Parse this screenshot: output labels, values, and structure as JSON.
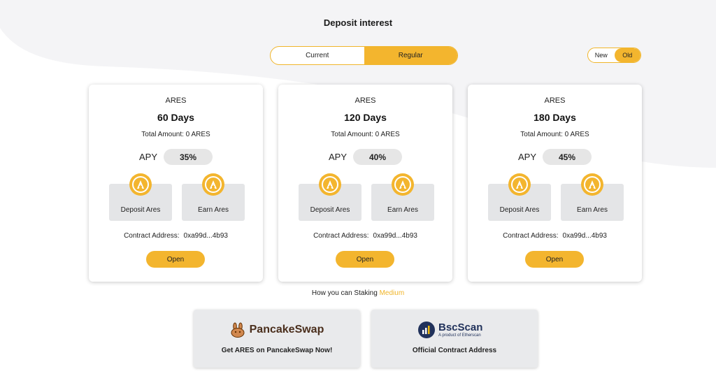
{
  "page": {
    "title": "Deposit interest"
  },
  "tabs": [
    {
      "label": "Current",
      "active": false
    },
    {
      "label": "Regular",
      "active": true
    }
  ],
  "version_toggle": [
    {
      "label": "New",
      "active": false
    },
    {
      "label": "Old",
      "active": true
    }
  ],
  "cards": [
    {
      "token": "ARES",
      "days": "60 Days",
      "total": "Total Amount: 0 ARES",
      "apy_label": "APY",
      "apy": "35%",
      "deposit_label": "Deposit Ares",
      "earn_label": "Earn Ares",
      "contract_label": "Contract Address:",
      "contract_address": "0xa99d...4b93",
      "open_label": "Open"
    },
    {
      "token": "ARES",
      "days": "120 Days",
      "total": "Total Amount: 0 ARES",
      "apy_label": "APY",
      "apy": "40%",
      "deposit_label": "Deposit Ares",
      "earn_label": "Earn Ares",
      "contract_label": "Contract Address:",
      "contract_address": "0xa99d...4b93",
      "open_label": "Open"
    },
    {
      "token": "ARES",
      "days": "180 Days",
      "total": "Total Amount: 0 ARES",
      "apy_label": "APY",
      "apy": "45%",
      "deposit_label": "Deposit Ares",
      "earn_label": "Earn Ares",
      "contract_label": "Contract Address:",
      "contract_address": "0xa99d...4b93",
      "open_label": "Open"
    }
  ],
  "howto": {
    "text": "How you can Staking",
    "link": "Medium"
  },
  "links": {
    "pancake": {
      "brand": "PancakeSwap",
      "caption": "Get ARES on PancakeSwap Now!"
    },
    "bscscan": {
      "brand": "BscScan",
      "sub": "A product of Etherscan",
      "caption": "Official Contract Address"
    }
  },
  "colors": {
    "accent": "#f3b52e",
    "card_bg": "#ffffff",
    "action_bg": "#e4e5e7",
    "pill_bg": "#e6e6e6"
  }
}
